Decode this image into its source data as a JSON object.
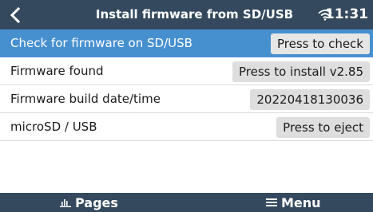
{
  "header": {
    "title": "Install firmware from SD/USB",
    "time": "11:31",
    "back_icon": "chevron-left-icon",
    "wifi_icon": "wifi-icon"
  },
  "rows": [
    {
      "label": "Check for firmware on SD/USB",
      "action": "Press to check",
      "selected": true
    },
    {
      "label": "Firmware found",
      "action": "Press to install v2.85",
      "selected": false
    },
    {
      "label": "Firmware build date/time",
      "action": "20220418130036",
      "selected": false
    },
    {
      "label": "microSD / USB",
      "action": "Press to eject",
      "selected": false
    }
  ],
  "footer": {
    "pages_label": "Pages",
    "pages_icon": "bar-chart-icon",
    "menu_label": "Menu",
    "menu_icon": "hamburger-menu-icon"
  },
  "colors": {
    "header_bg": "#34495e",
    "selected_row_bg": "#4790d0",
    "button_bg": "#dedede"
  }
}
